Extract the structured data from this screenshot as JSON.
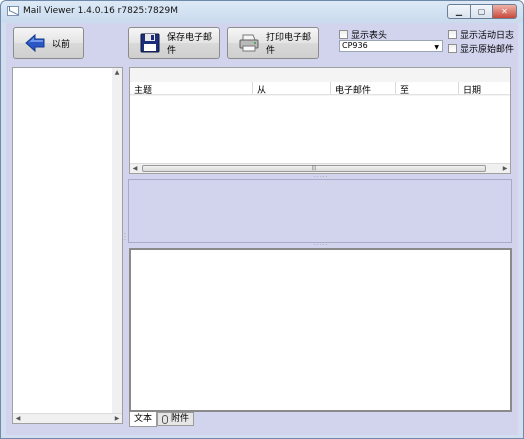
{
  "window": {
    "title": "Mail Viewer 1.4.0.16 r7825:7829M"
  },
  "toolbar": {
    "back_label": "以前",
    "save_label": "保存电子邮件",
    "print_label": "打印电子邮件"
  },
  "options": {
    "show_header_label": "显示表头",
    "encoding_value": "CP936",
    "show_activity_log_label": "显示活动日志",
    "show_raw_mail_label": "显示原始邮件"
  },
  "message_list": {
    "columns": [
      "主题",
      "从",
      "电子邮件",
      "至",
      "日期"
    ]
  },
  "tabs": [
    {
      "label": "文本"
    },
    {
      "label": "附件"
    }
  ],
  "colors": {
    "client_bg": "#d2d4ee",
    "back_arrow": "#2a56c6"
  }
}
